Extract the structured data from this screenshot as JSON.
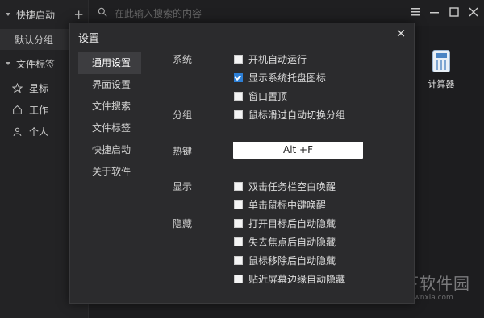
{
  "sidebar": {
    "launch_label": "快捷启动",
    "default_group": "默认分组",
    "tags_label": "文件标签",
    "tag_items": [
      {
        "label": "星标",
        "icon": "star-icon"
      },
      {
        "label": "工作",
        "icon": "home-icon"
      },
      {
        "label": "个人",
        "icon": "person-icon"
      }
    ]
  },
  "search": {
    "placeholder": "在此输入搜索的内容"
  },
  "desktop": {
    "app_label": "计算器"
  },
  "watermark": {
    "main": "当下软件园",
    "url": "www.downxia.com"
  },
  "dialog": {
    "title": "设置",
    "close": "×",
    "nav": [
      "通用设置",
      "界面设置",
      "文件搜索",
      "文件标签",
      "快捷启动",
      "关于软件"
    ],
    "active_nav": "通用设置",
    "sections": {
      "system": "系统",
      "group": "分组",
      "hotkey": "热键",
      "display": "显示",
      "hide": "隐藏"
    },
    "options": {
      "autostart": {
        "label": "开机自动运行",
        "checked": false
      },
      "tray_icon": {
        "label": "显示系统托盘图标",
        "checked": true
      },
      "window_top": {
        "label": "窗口置顶",
        "checked": false
      },
      "hover_switch": {
        "label": "鼠标滑过自动切换分组",
        "checked": false
      },
      "taskbar_dblclick": {
        "label": "双击任务栏空白唤醒",
        "checked": false
      },
      "middle_click": {
        "label": "单击鼠标中键唤醒",
        "checked": false
      },
      "hide_after_open": {
        "label": "打开目标后自动隐藏",
        "checked": false
      },
      "hide_on_blur": {
        "label": "失去焦点后自动隐藏",
        "checked": false
      },
      "hide_mouse_leave": {
        "label": "鼠标移除后自动隐藏",
        "checked": false
      },
      "hide_edge": {
        "label": "贴近屏幕边缘自动隐藏",
        "checked": false
      }
    },
    "hotkey_value": "Alt +F"
  },
  "colors": {
    "accent": "#2d7fd6",
    "dialog_bg": "#2b2b2d",
    "app_bg": "#1d1d1f"
  }
}
